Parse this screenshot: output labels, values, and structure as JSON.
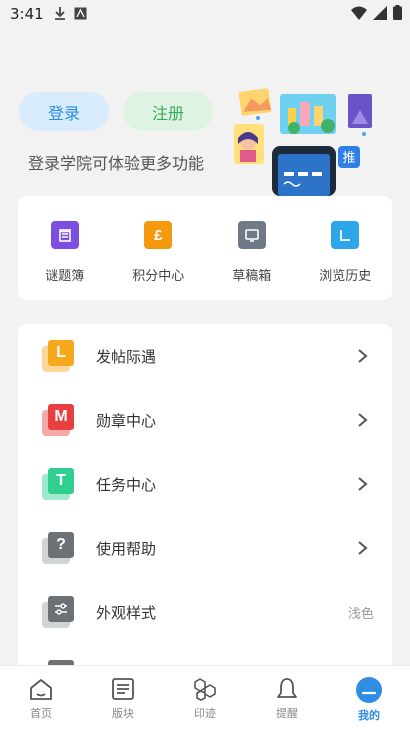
{
  "status_bar": {
    "time": "3:41"
  },
  "auth": {
    "login_label": "登录",
    "register_label": "注册",
    "tip": "登录学院可体验更多功能",
    "illustration_badge": "推"
  },
  "quick_links": [
    {
      "label": "谜题簿",
      "icon": "puzzle-book-icon",
      "color": "#7b4fe0"
    },
    {
      "label": "积分中心",
      "icon": "points-icon",
      "color": "#f59a0e"
    },
    {
      "label": "草稿箱",
      "icon": "drafts-icon",
      "color": "#6f7a86"
    },
    {
      "label": "浏览历史",
      "icon": "history-icon",
      "color": "#2ea6ea"
    }
  ],
  "menu": [
    {
      "letter": "L",
      "label": "发帖际遇",
      "color": "#f7a81c",
      "has_chevron": true,
      "value": ""
    },
    {
      "letter": "M",
      "label": "勋章中心",
      "color": "#e84040",
      "has_chevron": true,
      "value": ""
    },
    {
      "letter": "T",
      "label": "任务中心",
      "color": "#2ecf8f",
      "has_chevron": true,
      "value": ""
    },
    {
      "letter": "?",
      "label": "使用帮助",
      "color": "#6c7176",
      "has_chevron": true,
      "value": ""
    },
    {
      "letter": "",
      "label": "外观样式",
      "color": "#6c7176",
      "has_chevron": false,
      "value": "浅色"
    }
  ],
  "bottom_nav": [
    {
      "label": "首页",
      "icon": "home-icon",
      "active": false
    },
    {
      "label": "版块",
      "icon": "board-icon",
      "active": false
    },
    {
      "label": "印迹",
      "icon": "traces-icon",
      "active": false
    },
    {
      "label": "提醒",
      "icon": "bell-icon",
      "active": false
    },
    {
      "label": "我的",
      "icon": "profile-icon",
      "active": true
    }
  ],
  "colors": {
    "accent": "#2f8de4",
    "login_bg": "#d9ecfb",
    "register_bg": "#dff3e5"
  }
}
